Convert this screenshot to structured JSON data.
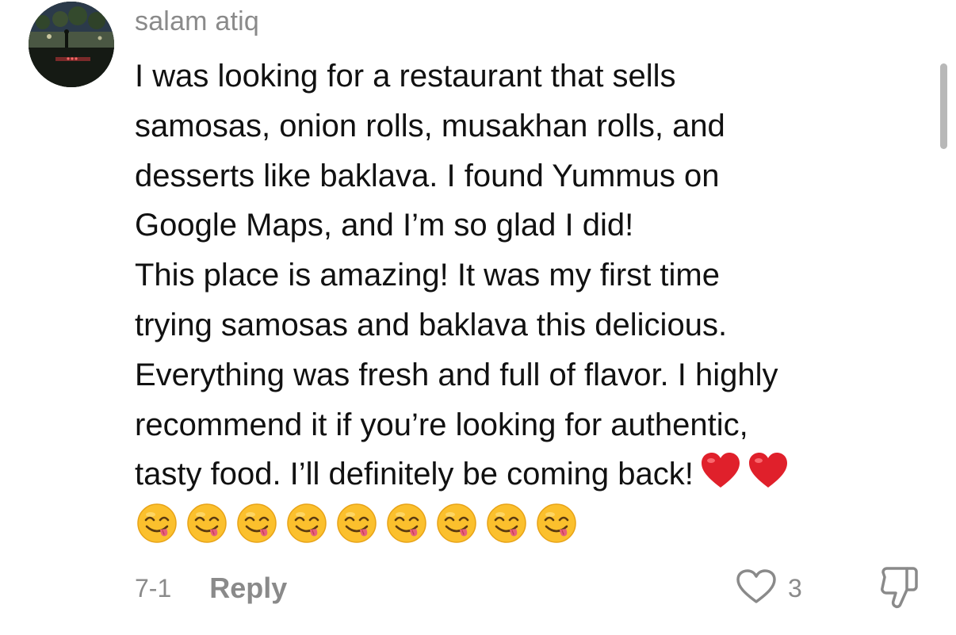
{
  "comment": {
    "author": "salam atiq",
    "text_lines": [
      "I was looking for a restaurant that sells",
      "samosas, onion rolls, musakhan rolls, and",
      "desserts like baklava. I found Yummus on",
      "Google Maps, and I’m so glad I did!",
      "This place is amazing! It was my first time",
      "trying samosas and baklava this delicious.",
      "Everything was fresh and full of flavor. I highly",
      "recommend it if you’re looking for authentic,",
      "tasty food. I’ll definitely be coming back!"
    ],
    "inline_emojis": [
      "red-heart",
      "red-heart"
    ],
    "emoji_row": [
      "face-savoring-food",
      "face-savoring-food",
      "face-savoring-food",
      "face-savoring-food",
      "face-savoring-food",
      "face-savoring-food",
      "face-savoring-food",
      "face-savoring-food",
      "face-savoring-food"
    ],
    "date": "7-1",
    "reply_label": "Reply",
    "like_count": "3"
  },
  "colors": {
    "muted_text": "#8a8a8a",
    "body_text": "#111111",
    "heart_red": "#e0202b",
    "emoji_yellow": "#fbc02d"
  }
}
